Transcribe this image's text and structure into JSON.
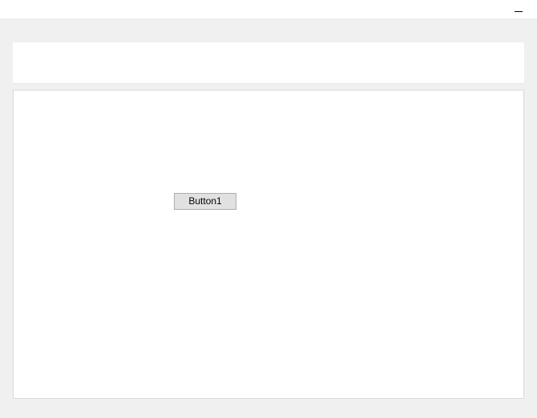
{
  "titlebar": {
    "minimize_label": "Minimize"
  },
  "main": {
    "button1_label": "Button1"
  }
}
